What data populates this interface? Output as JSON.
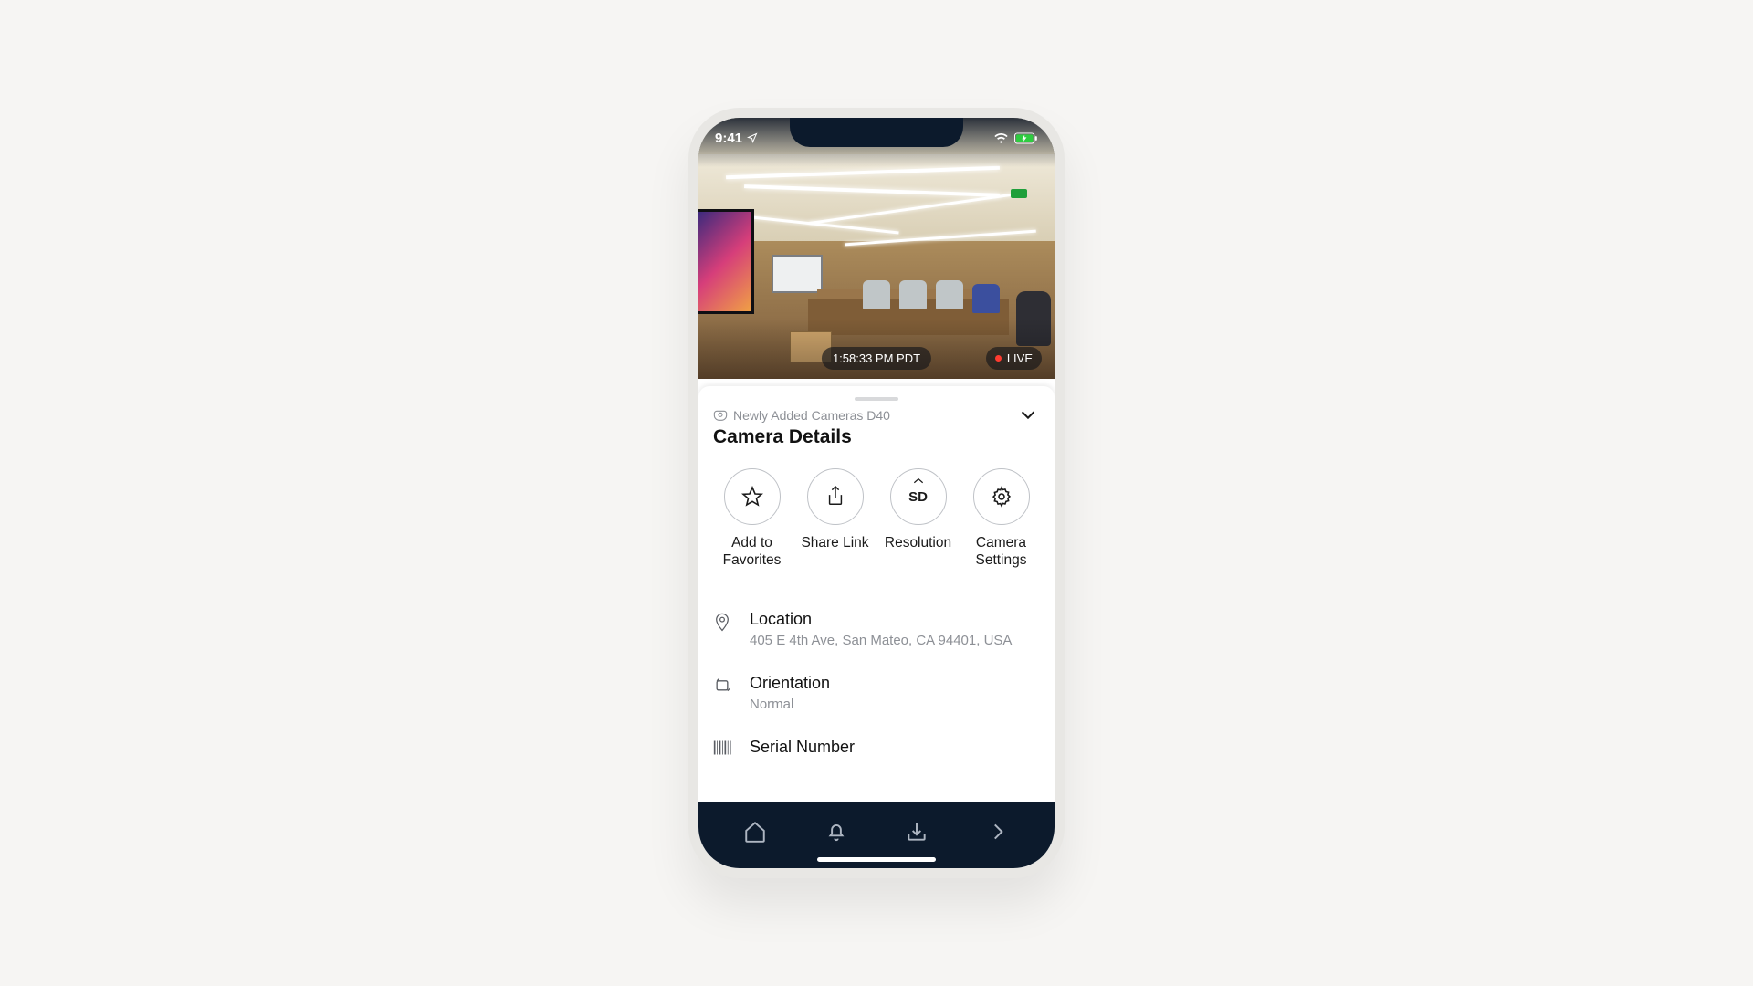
{
  "status": {
    "time": "9:41",
    "location_arrow": true,
    "wifi": true,
    "battery_charging": true
  },
  "feed": {
    "timestamp": "1:58:33 PM PDT",
    "live_label": "LIVE"
  },
  "sheet": {
    "breadcrumb": "Newly Added Cameras D40",
    "title": "Camera Details",
    "actions": {
      "favorite": "Add to Favorites",
      "share": "Share Link",
      "resolution": "Resolution",
      "resolution_value": "SD",
      "settings": "Camera Settings"
    },
    "rows": {
      "location": {
        "label": "Location",
        "value": "405 E 4th Ave, San Mateo, CA 94401, USA"
      },
      "orientation": {
        "label": "Orientation",
        "value": "Normal"
      },
      "serial": {
        "label": "Serial Number"
      }
    }
  },
  "tabs": {
    "home": "home",
    "alerts": "alerts",
    "downloads": "downloads",
    "more": "more"
  }
}
